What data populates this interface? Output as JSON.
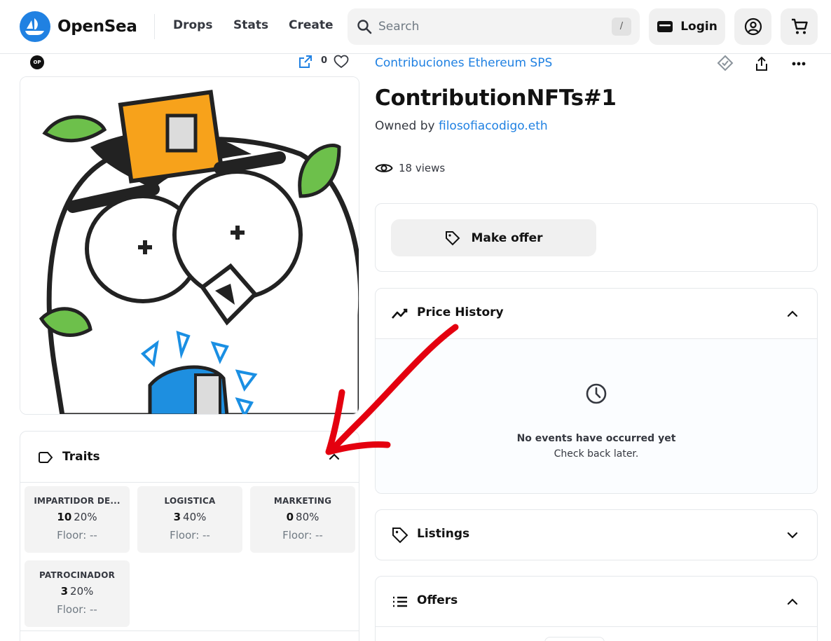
{
  "header": {
    "brand": "OpenSea",
    "nav": {
      "drops": "Drops",
      "stats": "Stats",
      "create": "Create"
    },
    "search": {
      "placeholder": "Search",
      "shortcut": "/"
    },
    "login_label": "Login"
  },
  "media": {
    "chain_badge": "OP",
    "favorites_count": "0"
  },
  "traits": {
    "title": "Traits",
    "items": [
      {
        "type": "IMPARTIDOR DE...",
        "value": "10",
        "percent": "20%",
        "floor": "Floor: --"
      },
      {
        "type": "LOGISTICA",
        "value": "3",
        "percent": "40%",
        "floor": "Floor: --"
      },
      {
        "type": "MARKETING",
        "value": "0",
        "percent": "80%",
        "floor": "Floor: --"
      },
      {
        "type": "PATROCINADOR",
        "value": "3",
        "percent": "20%",
        "floor": "Floor: --"
      }
    ]
  },
  "item": {
    "collection": "Contribuciones Ethereum SPS",
    "title": "ContributionNFTs#1",
    "owned_by_label": "Owned by",
    "owner": "filosofiacodigo.eth",
    "views": "18 views"
  },
  "offer_panel": {
    "make_offer_label": "Make offer"
  },
  "price_history": {
    "title": "Price History",
    "empty_title": "No events have occurred yet",
    "empty_subtitle": "Check back later."
  },
  "listings": {
    "title": "Listings"
  },
  "offers": {
    "title": "Offers"
  },
  "colors": {
    "accent": "#2081e2",
    "brand": "#2081e2",
    "annotation": "#e4000f"
  },
  "icons": [
    "opensea-logo-icon",
    "search-icon",
    "wallet-icon",
    "account-icon",
    "cart-icon",
    "external-link-icon",
    "heart-icon",
    "tag-icon",
    "chevron-up-icon",
    "verified-icon",
    "share-icon",
    "more-icon",
    "eye-icon",
    "chart-line-icon",
    "clock-icon",
    "chevron-down-icon",
    "list-icon"
  ]
}
